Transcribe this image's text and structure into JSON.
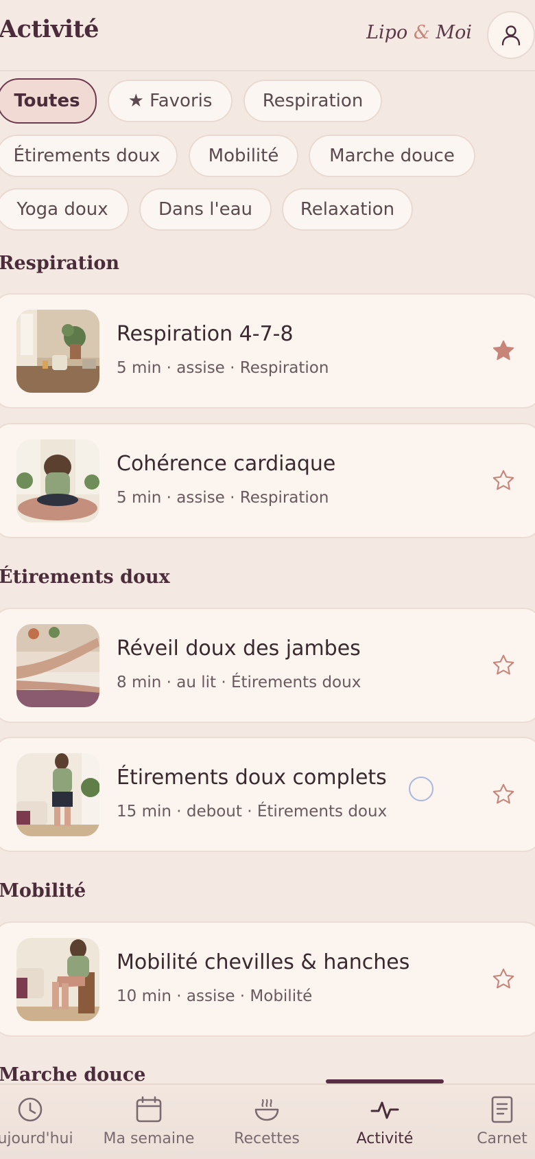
{
  "header": {
    "title": "Activité",
    "brand_part1": "Lipo",
    "brand_amp": "&",
    "brand_part2": "Moi",
    "profile_icon": "user-icon"
  },
  "filters": [
    {
      "label": "Toutes",
      "active": true
    },
    {
      "label": "★ Favoris",
      "active": false
    },
    {
      "label": "Respiration",
      "active": false
    },
    {
      "label": "Étirements doux",
      "active": false
    },
    {
      "label": "Mobilité",
      "active": false
    },
    {
      "label": "Marche douce",
      "active": false
    },
    {
      "label": "Yoga doux",
      "active": false
    },
    {
      "label": "Dans l'eau",
      "active": false
    },
    {
      "label": "Relaxation",
      "active": false
    }
  ],
  "sections": [
    {
      "title": "Respiration",
      "items": [
        {
          "title": "Respiration 4-7-8",
          "meta": "5 min · assise · Respiration",
          "favorite": true
        },
        {
          "title": "Cohérence cardiaque",
          "meta": "5 min · assise · Respiration",
          "favorite": false
        }
      ]
    },
    {
      "title": "Étirements doux",
      "items": [
        {
          "title": "Réveil doux des jambes",
          "meta": "8 min · au lit · Étirements doux",
          "favorite": false
        },
        {
          "title": "Étirements doux complets",
          "meta": "15 min · debout · Étirements doux",
          "favorite": false
        }
      ]
    },
    {
      "title": "Mobilité",
      "items": [
        {
          "title": "Mobilité chevilles & hanches",
          "meta": "10 min · assise · Mobilité",
          "favorite": false
        }
      ]
    },
    {
      "title": "Marche douce",
      "items": []
    }
  ],
  "nav": [
    {
      "label": "Aujourd'hui",
      "icon": "clock-icon",
      "active": false
    },
    {
      "label": "Ma semaine",
      "icon": "calendar-icon",
      "active": false
    },
    {
      "label": "Recettes",
      "icon": "bowl-icon",
      "active": false
    },
    {
      "label": "Activité",
      "icon": "activity-icon",
      "active": true
    },
    {
      "label": "Carnet",
      "icon": "notebook-icon",
      "active": false
    }
  ],
  "colors": {
    "background": "#f4e9e2",
    "accent": "#c7857a",
    "primary": "#4a2c3a",
    "active_chip_bg": "#f1d9d4"
  }
}
